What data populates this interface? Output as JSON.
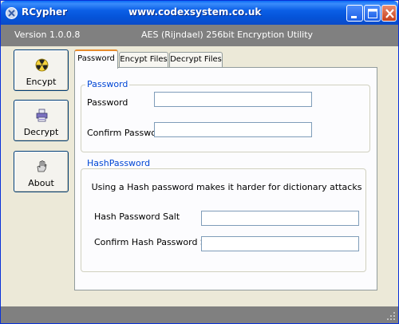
{
  "window": {
    "title": "RCypher",
    "url": "www.codexsystem.co.uk",
    "accent": "#0553d8"
  },
  "header": {
    "version": "Version 1.0.0.8",
    "utility": "AES (Rijndael) 256bit Encryption Utility"
  },
  "sidebar": {
    "items": [
      {
        "label": "Encypt",
        "icon": "radiation-icon"
      },
      {
        "label": "Decrypt",
        "icon": "printer-icon"
      },
      {
        "label": "About",
        "icon": "hand-icon"
      }
    ]
  },
  "tabs": [
    {
      "label": "Password",
      "active": true
    },
    {
      "label": "Encypt Files",
      "active": false
    },
    {
      "label": "Decrypt Files",
      "active": false
    }
  ],
  "password_group": {
    "title": "Password",
    "password_label": "Password",
    "password_value": "",
    "confirm_label": "Confirm Password",
    "confirm_value": ""
  },
  "hash_group": {
    "title": "HashPassword",
    "info": "Using a Hash password makes it harder for dictionary attacks",
    "salt_label": "Hash Password Salt",
    "salt_value": "",
    "confirm_salt_label": "Confirm Hash Password Salt",
    "confirm_salt_value": ""
  }
}
